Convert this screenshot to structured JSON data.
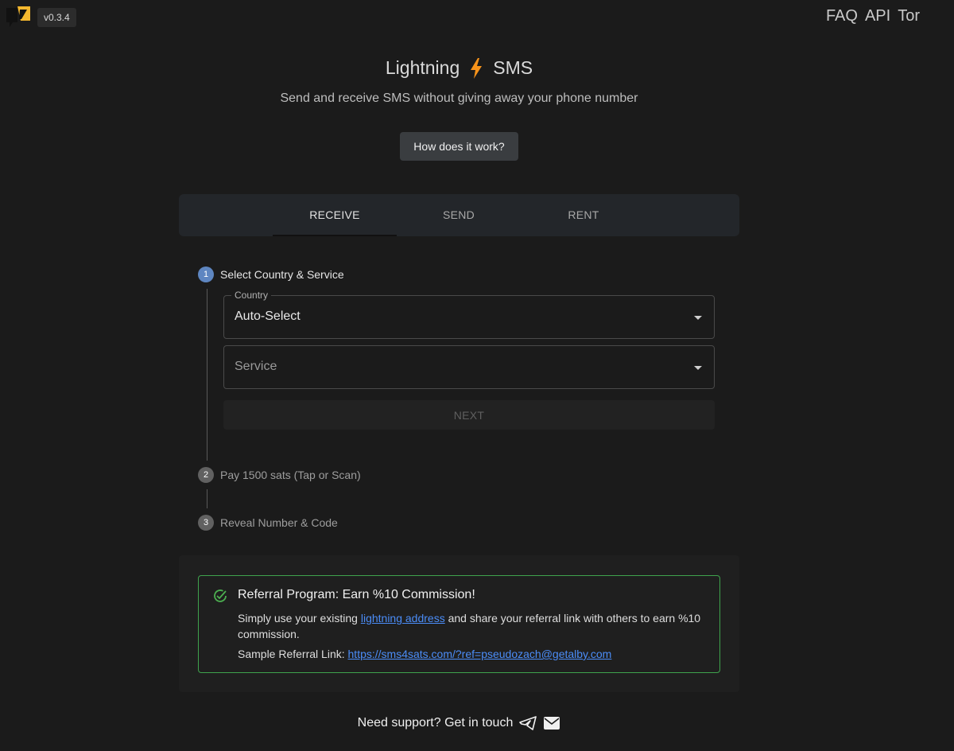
{
  "header": {
    "version": "v0.3.4",
    "nav": [
      "FAQ",
      "API",
      "Tor"
    ]
  },
  "hero": {
    "title_left": "Lightning",
    "title_right": "SMS",
    "subtitle": "Send and receive SMS without giving away your phone number",
    "how_button": "How does it work?"
  },
  "tabs": [
    {
      "label": "RECEIVE",
      "active": true
    },
    {
      "label": "SEND",
      "active": false
    },
    {
      "label": "RENT",
      "active": false
    }
  ],
  "steps": [
    {
      "num": "1",
      "label": "Select Country & Service",
      "active": true
    },
    {
      "num": "2",
      "label": "Pay 1500 sats (Tap or Scan)",
      "active": false
    },
    {
      "num": "3",
      "label": "Reveal Number & Code",
      "active": false
    }
  ],
  "form": {
    "country_label": "Country",
    "country_value": "Auto-Select",
    "service_placeholder": "Service",
    "next_label": "NEXT"
  },
  "referral": {
    "title": "Referral Program: Earn %10 Commission!",
    "body_before": "Simply use your existing ",
    "link_text": "lightning address",
    "body_after": " and share your referral link with others to earn %10 commission.",
    "sample_label": "Sample Referral Link: ",
    "sample_link": "https://sms4sats.com/?ref=pseudozach@getalby.com"
  },
  "footer": {
    "text": "Need support? Get in touch"
  },
  "colors": {
    "background": "#1b1b1b",
    "accent_bolt": "#f7931a",
    "step_active": "#5e86c1",
    "success_border": "#3fa34d",
    "link": "#4b8df8"
  },
  "icons": [
    "logo-icon",
    "lightning-bolt-icon",
    "dropdown-caret-icon",
    "check-circle-icon",
    "telegram-icon",
    "email-icon"
  ]
}
